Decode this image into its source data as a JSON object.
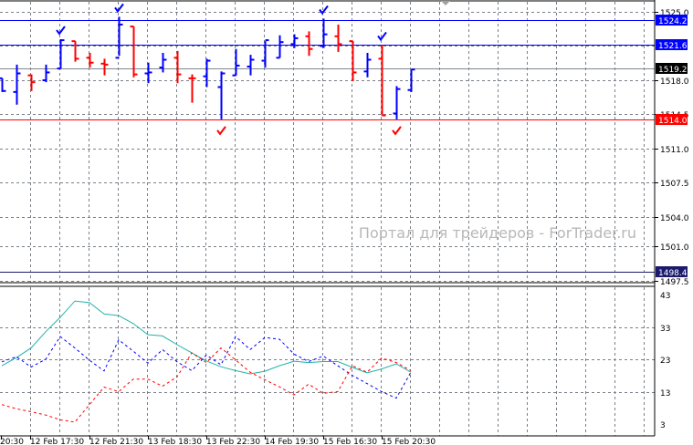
{
  "chart_data": {
    "type": "ohlc",
    "price_axis": {
      "min": 1497.5,
      "max": 1525.0,
      "ticks": [
        "1525.0",
        "1518.0",
        "1514.5",
        "1511.0",
        "1507.5",
        "1504.0",
        "1501.0",
        "1497.5"
      ],
      "tick_values": [
        1525.0,
        1518.0,
        1514.5,
        1511.0,
        1507.5,
        1504.0,
        1501.0,
        1497.5
      ],
      "grid_values": [
        1525.0,
        1521.5,
        1518.0,
        1514.5,
        1511.0,
        1507.5,
        1504.0,
        1501.0,
        1497.5
      ]
    },
    "levels": [
      {
        "label": "1524.2",
        "value": 1524.2,
        "color": "#0000ff",
        "text_color": "#ffffff"
      },
      {
        "label": "1521.6",
        "value": 1521.6,
        "color": "#0000ff",
        "text_color": "#ffffff"
      },
      {
        "label": "1519.2",
        "value": 1519.2,
        "color": "#000000",
        "line_color": "#808890",
        "text_color": "#ffffff"
      },
      {
        "label": "1514.0",
        "value": 1514.0,
        "color": "#ff0000",
        "text_color": "#ffffff"
      },
      {
        "label": "1498.4",
        "value": 1498.4,
        "color": "#1a1a6e",
        "text_color": "#ffffff"
      }
    ],
    "bars": [
      {
        "o": 1518.2,
        "h": 1518.2,
        "l": 1516.8,
        "c": 1516.9,
        "color": "blue"
      },
      {
        "o": 1516.8,
        "h": 1519.6,
        "l": 1515.5,
        "c": 1518.7,
        "color": "blue"
      },
      {
        "o": 1518.5,
        "h": 1518.6,
        "l": 1516.9,
        "c": 1517.8,
        "color": "red"
      },
      {
        "o": 1518.0,
        "h": 1519.6,
        "l": 1517.8,
        "c": 1518.8,
        "color": "blue"
      },
      {
        "o": 1519.2,
        "h": 1522.2,
        "l": 1519.2,
        "c": 1522.1,
        "color": "blue"
      },
      {
        "o": 1522.0,
        "h": 1522.0,
        "l": 1519.9,
        "c": 1520.2,
        "color": "red"
      },
      {
        "o": 1520.3,
        "h": 1520.8,
        "l": 1519.3,
        "c": 1519.8,
        "color": "red"
      },
      {
        "o": 1519.7,
        "h": 1520.2,
        "l": 1518.5,
        "c": 1519.6,
        "color": "red"
      },
      {
        "o": 1520.3,
        "h": 1524.5,
        "l": 1520.5,
        "c": 1523.7,
        "color": "blue"
      },
      {
        "o": 1523.5,
        "h": 1523.5,
        "l": 1518.3,
        "c": 1518.6,
        "color": "red"
      },
      {
        "o": 1518.7,
        "h": 1519.8,
        "l": 1517.7,
        "c": 1518.8,
        "color": "blue"
      },
      {
        "o": 1519.3,
        "h": 1520.8,
        "l": 1518.8,
        "c": 1520.1,
        "color": "blue"
      },
      {
        "o": 1520.3,
        "h": 1521.0,
        "l": 1517.7,
        "c": 1518.6,
        "color": "red"
      },
      {
        "o": 1518.2,
        "h": 1518.6,
        "l": 1515.7,
        "c": 1518.2,
        "color": "red"
      },
      {
        "o": 1518.4,
        "h": 1520.2,
        "l": 1517.3,
        "c": 1520.0,
        "color": "blue"
      },
      {
        "o": 1517.3,
        "h": 1518.9,
        "l": 1514.0,
        "c": 1518.7,
        "color": "blue"
      },
      {
        "o": 1518.5,
        "h": 1521.2,
        "l": 1518.5,
        "c": 1519.5,
        "color": "blue"
      },
      {
        "o": 1519.4,
        "h": 1520.6,
        "l": 1518.5,
        "c": 1520.1,
        "color": "blue"
      },
      {
        "o": 1520.0,
        "h": 1522.0,
        "l": 1519.3,
        "c": 1522.1,
        "color": "blue"
      },
      {
        "o": 1520.3,
        "h": 1522.6,
        "l": 1520.3,
        "c": 1521.9,
        "color": "blue"
      },
      {
        "o": 1521.7,
        "h": 1522.7,
        "l": 1521.3,
        "c": 1522.3,
        "color": "blue"
      },
      {
        "o": 1522.5,
        "h": 1523.0,
        "l": 1520.5,
        "c": 1521.2,
        "color": "red"
      },
      {
        "o": 1521.5,
        "h": 1524.3,
        "l": 1521.3,
        "c": 1522.7,
        "color": "blue"
      },
      {
        "o": 1522.5,
        "h": 1523.7,
        "l": 1520.9,
        "c": 1521.7,
        "color": "red"
      },
      {
        "o": 1522.0,
        "h": 1522.0,
        "l": 1517.9,
        "c": 1518.8,
        "color": "red"
      },
      {
        "o": 1518.9,
        "h": 1520.8,
        "l": 1518.3,
        "c": 1520.1,
        "color": "blue"
      },
      {
        "o": 1520.2,
        "h": 1521.6,
        "l": 1514.4,
        "c": 1514.4,
        "color": "red"
      },
      {
        "o": 1514.6,
        "h": 1517.4,
        "l": 1514.0,
        "c": 1517.1,
        "color": "blue"
      },
      {
        "o": 1517.0,
        "h": 1519.1,
        "l": 1516.8,
        "c": 1519.1,
        "color": "blue"
      }
    ],
    "signals": [
      {
        "bar": 4,
        "type": "up",
        "color": "#0000ff"
      },
      {
        "bar": 8,
        "type": "up",
        "color": "#0000ff"
      },
      {
        "bar": 22,
        "type": "up",
        "color": "#0000ff"
      },
      {
        "bar": 26,
        "type": "up",
        "color": "#0000ff"
      },
      {
        "bar": 15,
        "type": "down",
        "color": "#ff0000"
      },
      {
        "bar": 27,
        "type": "down",
        "color": "#ff0000"
      }
    ],
    "indicator": {
      "type": "line",
      "ylim": [
        3,
        43
      ],
      "ticks": [
        "43",
        "33",
        "23",
        "13",
        "3"
      ],
      "tick_values": [
        43,
        33,
        23,
        13,
        3
      ],
      "series": [
        {
          "name": "adx",
          "color": "#20b2aa",
          "style": "solid",
          "values": [
            21,
            23.5,
            26.5,
            31.5,
            36,
            41,
            40.5,
            37,
            36.5,
            34,
            30.6,
            30.2,
            27.5,
            25,
            22.5,
            20.7,
            19.5,
            18.5,
            19.3,
            21,
            22.4,
            22,
            22.3,
            22.3,
            20.5,
            18.8,
            20,
            21.6,
            19
          ]
        },
        {
          "name": "plus-di",
          "color": "#0000ff",
          "style": "dashed",
          "values": [
            22.2,
            23.8,
            20.6,
            23,
            30,
            26.5,
            22.7,
            19.4,
            29,
            25.5,
            21.8,
            26,
            22.2,
            19.5,
            24.3,
            21.3,
            30,
            26,
            29.7,
            29.2,
            24.6,
            22.3,
            24,
            21,
            18,
            15.5,
            13,
            11,
            19
          ]
        },
        {
          "name": "minus-di",
          "color": "#ff0000",
          "style": "dashed",
          "values": [
            9,
            7.7,
            6.8,
            5.8,
            4.3,
            3.6,
            9,
            14.4,
            13,
            16.9,
            16.9,
            14.7,
            17.6,
            25,
            22,
            26.5,
            22.8,
            19,
            16.7,
            14.5,
            12,
            15.3,
            12.5,
            13,
            21,
            19,
            23.4,
            22,
            19.5
          ]
        }
      ]
    },
    "time_labels": [
      "20:30",
      "12 Feb 17:30",
      "12 Feb 21:30",
      "13 Feb 18:30",
      "13 Feb 22:30",
      "14 Feb 19:30",
      "15 Feb 16:30",
      "15 Feb 20:30"
    ]
  },
  "watermark": "Портал для трейдеров - ForTrader.ru"
}
